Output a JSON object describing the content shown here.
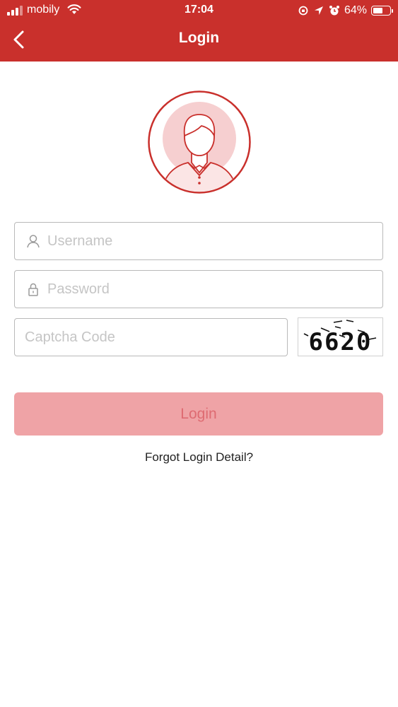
{
  "status_bar": {
    "carrier": "mobily",
    "time": "17:04",
    "battery_percent": "64%",
    "battery_level": 0.64,
    "icons": [
      "signal-icon",
      "wifi-icon",
      "orientation-lock-icon",
      "location-arrow-icon",
      "alarm-icon",
      "battery-icon"
    ]
  },
  "header": {
    "title": "Login",
    "back_icon": "chevron-left-icon",
    "color": "#c9302c"
  },
  "avatar": {
    "icon": "user-avatar-icon"
  },
  "form": {
    "username": {
      "placeholder": "Username",
      "value": "",
      "icon": "user-icon"
    },
    "password": {
      "placeholder": "Password",
      "value": "",
      "icon": "lock-icon"
    },
    "captcha": {
      "placeholder": "Captcha Code",
      "value": "",
      "image_text": "6620"
    },
    "login_label": "Login",
    "login_color": "#efa3a6"
  },
  "forgot_link": "Forgot Login Detail?"
}
